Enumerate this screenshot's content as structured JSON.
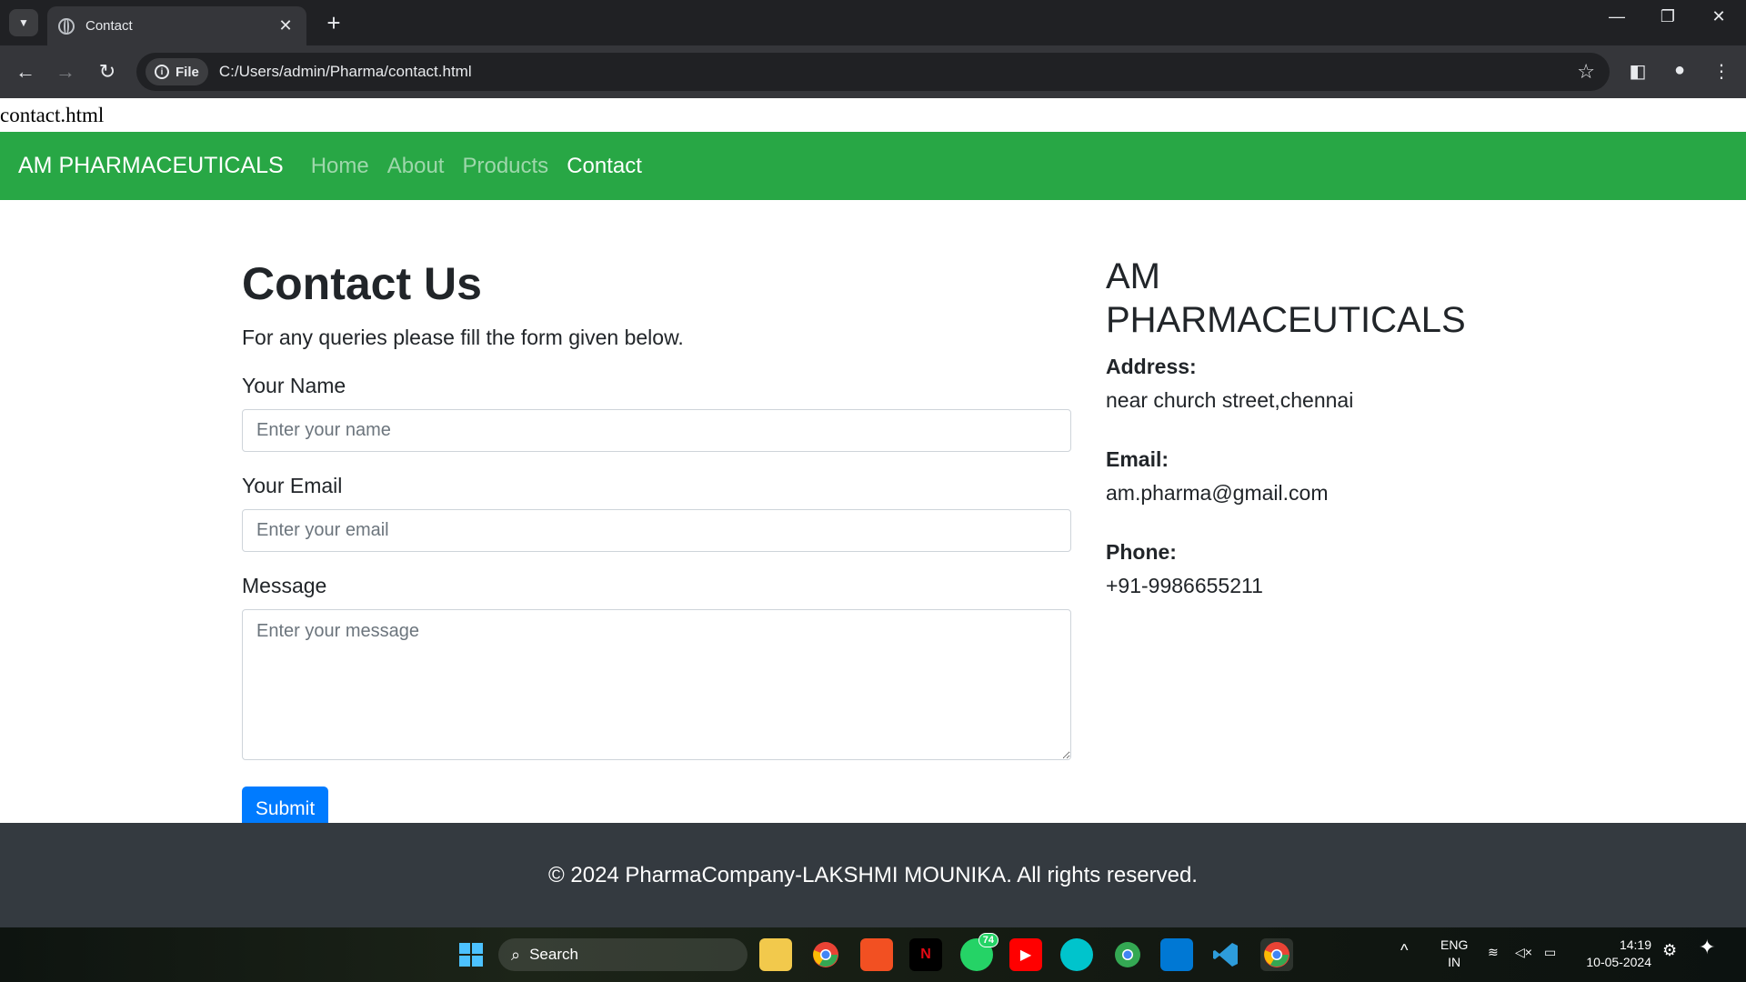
{
  "browser": {
    "tab_title": "Contact",
    "file_chip": "File",
    "url": "C:/Users/admin/Pharma/contact.html"
  },
  "page_file_label": "contact.html",
  "navbar": {
    "brand": "AM PHARMACEUTICALS",
    "links": [
      "Home",
      "About",
      "Products",
      "Contact"
    ],
    "active": "Contact"
  },
  "contact": {
    "title": "Contact Us",
    "subtitle": "For any queries please fill the form given below.",
    "name_label": "Your Name",
    "name_placeholder": "Enter your name",
    "email_label": "Your Email",
    "email_placeholder": "Enter your email",
    "message_label": "Message",
    "message_placeholder": "Enter your message",
    "submit_label": "Submit"
  },
  "sidebar": {
    "company_line1": "AM",
    "company_line2": "PHARMACEUTICALS",
    "address_label": "Address:",
    "address_value": "near church street,chennai",
    "email_label": "Email:",
    "email_value": "am.pharma@gmail.com",
    "phone_label": "Phone:",
    "phone_value": "+91-9986655211"
  },
  "footer": {
    "text": "© 2024 PharmaCompany-LAKSHMI MOUNIKA. All rights reserved."
  },
  "taskbar": {
    "search_label": "Search",
    "whatsapp_badge": "74",
    "lang_line1": "ENG",
    "lang_line2": "IN",
    "time": "14:19",
    "date": "10-05-2024"
  },
  "colors": {
    "navbar_bg": "#28a745",
    "button_bg": "#007bff",
    "footer_bg": "#343a40"
  }
}
